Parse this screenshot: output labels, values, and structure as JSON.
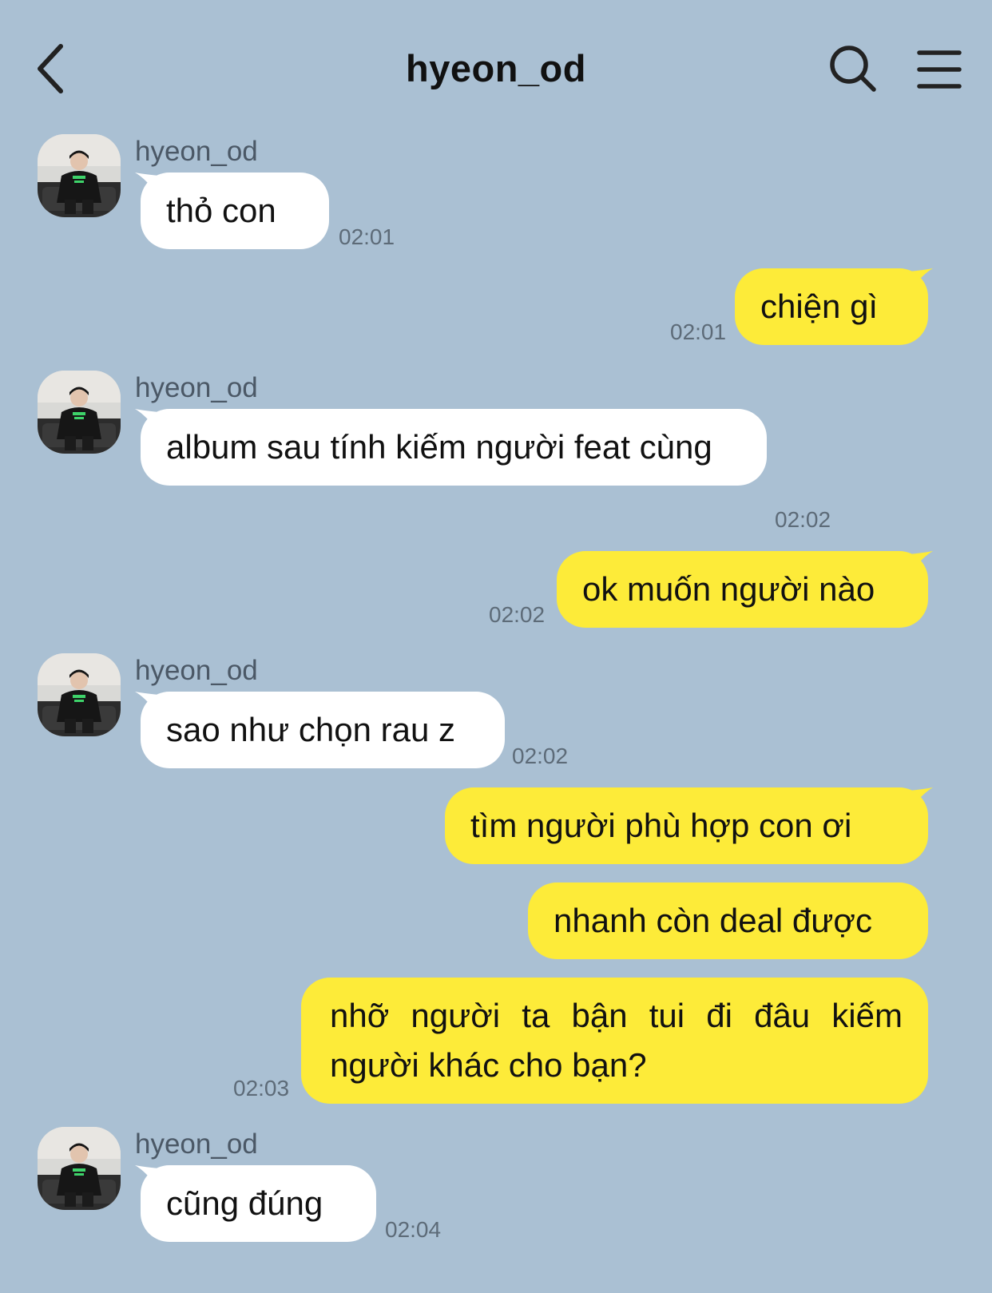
{
  "header": {
    "title": "hyeon_od",
    "back_icon": "chevron-left-icon",
    "search_icon": "search-icon",
    "menu_icon": "hamburger-menu-icon"
  },
  "colors": {
    "background": "#aac0d3",
    "incoming_bubble": "#ffffff",
    "outgoing_bubble": "#fdeb39"
  },
  "messages": [
    {
      "sender": "hyeon_od",
      "direction": "in",
      "text": "thỏ con",
      "time": "02:01"
    },
    {
      "sender": "me",
      "direction": "out",
      "text": "chiện gì",
      "time": "02:01"
    },
    {
      "sender": "hyeon_od",
      "direction": "in",
      "text": "album sau tính kiếm người feat cùng",
      "time": "02:02"
    },
    {
      "sender": "me",
      "direction": "out",
      "text": "ok muốn người nào",
      "time": "02:02"
    },
    {
      "sender": "hyeon_od",
      "direction": "in",
      "text": "sao như chọn rau z",
      "time": "02:02"
    },
    {
      "sender": "me",
      "direction": "out",
      "text": "tìm người phù hợp con ơi",
      "time": ""
    },
    {
      "sender": "me",
      "direction": "out",
      "text": "nhanh còn deal được",
      "time": ""
    },
    {
      "sender": "me",
      "direction": "out",
      "text": "nhỡ người ta bận tui đi đâu kiếm người khác cho bạn?",
      "time": "02:03"
    },
    {
      "sender": "hyeon_od",
      "direction": "in",
      "text": "cũng đúng",
      "time": "02:04"
    }
  ]
}
